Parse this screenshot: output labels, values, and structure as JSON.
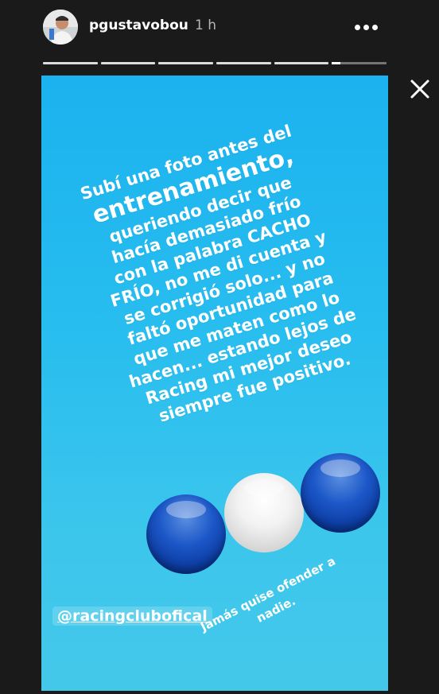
{
  "header": {
    "username": "pgustavobou",
    "time_ago": "1 h"
  },
  "progress": {
    "segments": 6,
    "active_index": 5,
    "active_fraction": 0.15
  },
  "story": {
    "caption_line1": "Subí una foto antes del",
    "caption_big": "entrenamiento,",
    "caption_rest": [
      "queriendo decir que",
      "hacía demasiado frío",
      "con la palabra CACHO",
      "FRÍO, no me di cuenta y",
      "se corrigió solo... y no",
      "faltó oportunidad para",
      "que me maten como lo",
      "hacen... estando lejos de",
      "Racing mi mejor deseo",
      "siempre fue positivo."
    ],
    "mention": "@racingclubofical",
    "note_line1": "Jamás quise ofender a",
    "note_line2": "nadie.",
    "background_colors": [
      "#1bb2ef",
      "#44c8ea"
    ],
    "ball_colors": [
      "#1c57c8",
      "#f2f2f2",
      "#1c57c8"
    ]
  },
  "icons": {
    "more": "more-horizontal-icon",
    "close": "close-icon"
  }
}
